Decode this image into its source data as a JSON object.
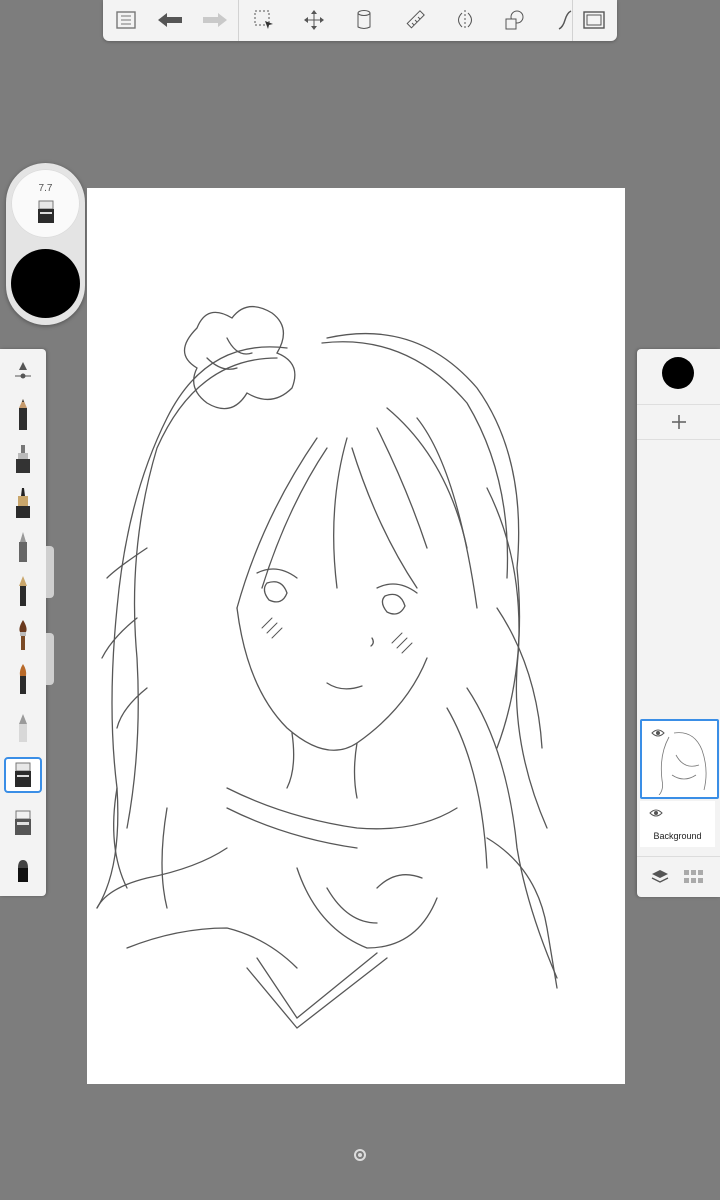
{
  "app": {
    "brush_size": "7.7",
    "current_color": "#000000",
    "accent_color": "#3a8ee6"
  },
  "toolbar": {
    "tools": [
      "menu-icon",
      "undo-icon",
      "redo-icon",
      "selection-icon",
      "transform-icon",
      "fill-icon",
      "ruler-icon",
      "symmetry-icon",
      "shape-icon",
      "stroke-icon",
      "fullscreen-icon"
    ]
  },
  "brushes": [
    "brush-size-adjust",
    "pencil",
    "marker",
    "felt-pen",
    "ballpoint",
    "fountain-pen",
    "paintbrush",
    "airbrush",
    "smudge",
    "eraser",
    "hard-eraser",
    "soft-eraser"
  ],
  "layers": {
    "items": [
      {
        "label": "",
        "visible": true,
        "selected": true
      },
      {
        "label": "Background",
        "visible": true,
        "selected": false
      }
    ]
  }
}
